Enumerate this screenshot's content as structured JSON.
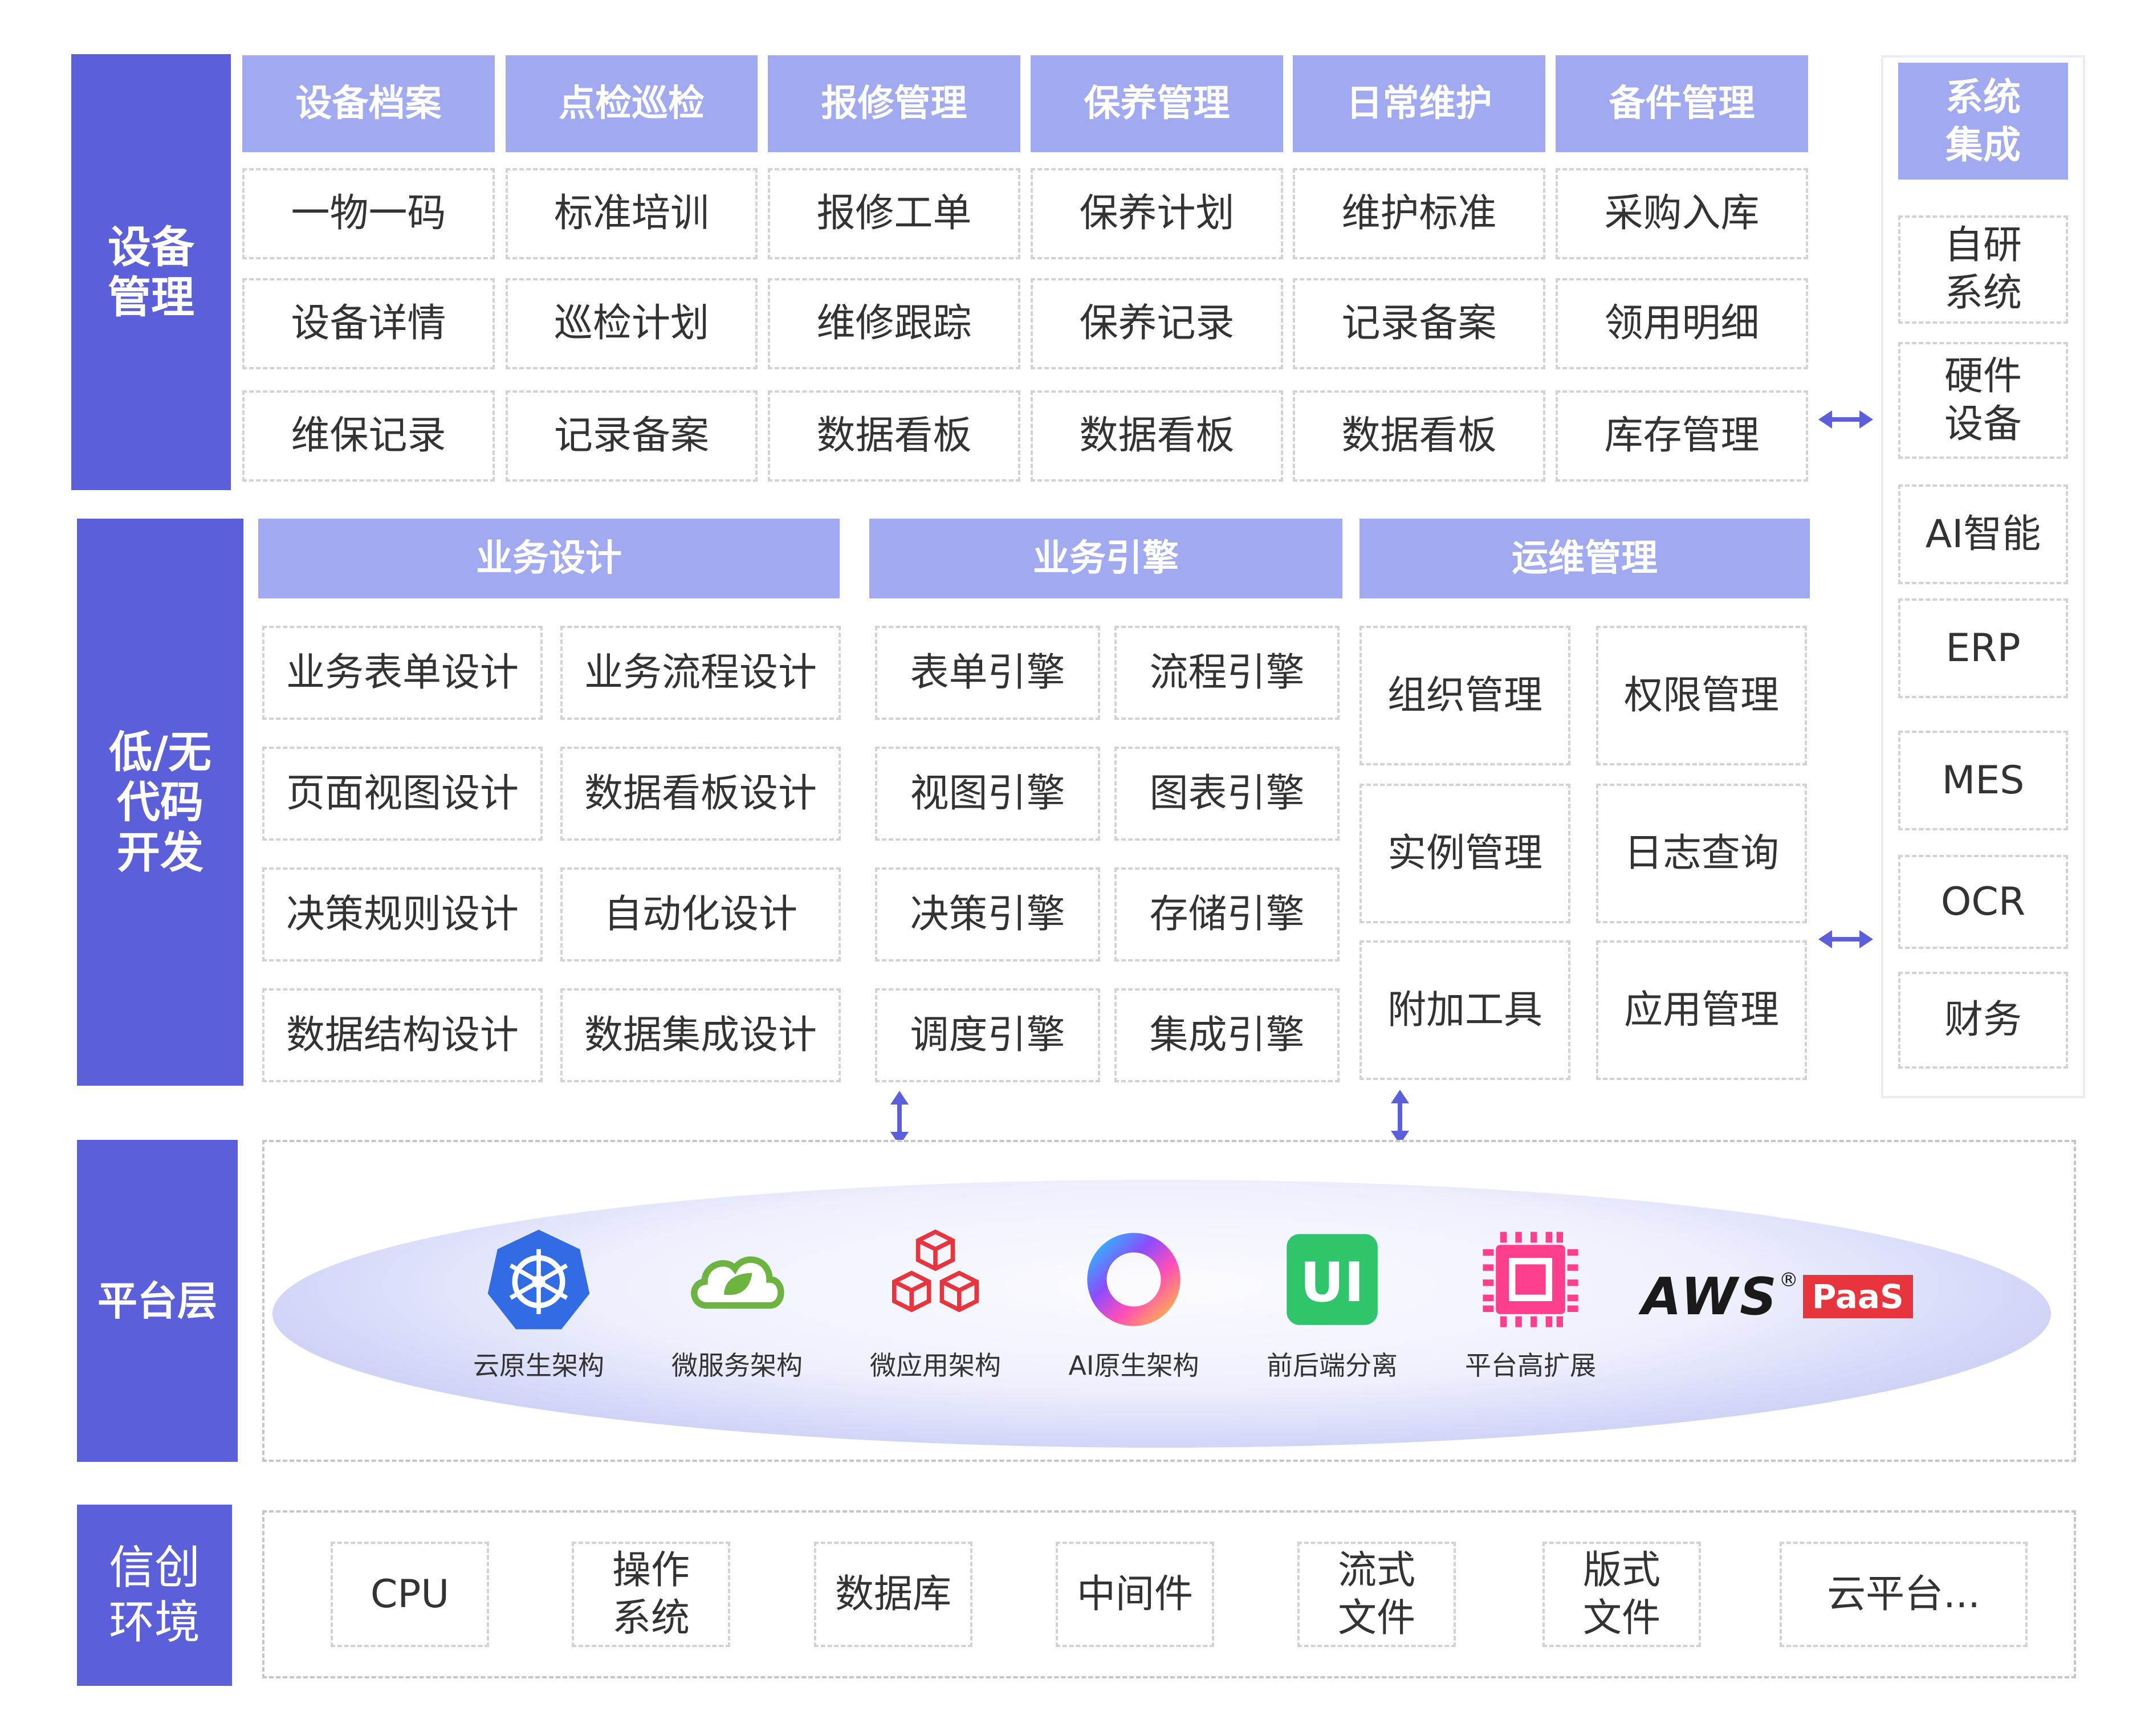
{
  "equipment": {
    "side_label": "设备\n管理",
    "headers": [
      "设备档案",
      "点检巡检",
      "报修管理",
      "保养管理",
      "日常维护",
      "备件管理"
    ],
    "rows": [
      [
        "一物一码",
        "标准培训",
        "报修工单",
        "保养计划",
        "维护标准",
        "采购入库"
      ],
      [
        "设备详情",
        "巡检计划",
        "维修跟踪",
        "保养记录",
        "记录备案",
        "领用明细"
      ],
      [
        "维保记录",
        "记录备案",
        "数据看板",
        "数据看板",
        "数据看板",
        "库存管理"
      ]
    ]
  },
  "system_integration": {
    "header": "系统\n集成",
    "items": [
      "自研\n系统",
      "硬件\n设备",
      "AI智能",
      "ERP",
      "MES",
      "OCR",
      "财务"
    ]
  },
  "lowcode": {
    "side_label": "低/无\n代码\n开发",
    "design": {
      "header": "业务设计",
      "items": [
        "业务表单设计",
        "业务流程设计",
        "页面视图设计",
        "数据看板设计",
        "决策规则设计",
        "自动化设计",
        "数据结构设计",
        "数据集成设计"
      ]
    },
    "engine": {
      "header": "业务引擎",
      "items": [
        "表单引擎",
        "流程引擎",
        "视图引擎",
        "图表引擎",
        "决策引擎",
        "存储引擎",
        "调度引擎",
        "集成引擎"
      ]
    },
    "ops": {
      "header": "运维管理",
      "items": [
        "组织管理",
        "权限管理",
        "实例管理",
        "日志查询",
        "附加工具",
        "应用管理"
      ]
    }
  },
  "platform": {
    "side_label": "平台层",
    "items": [
      {
        "label": "云原生架构",
        "icon": "kubernetes-icon"
      },
      {
        "label": "微服务架构",
        "icon": "spring-cloud-icon"
      },
      {
        "label": "微应用架构",
        "icon": "cubes-icon"
      },
      {
        "label": "AI原生架构",
        "icon": "ai-ring-icon"
      },
      {
        "label": "前后端分离",
        "icon": "ui-icon"
      },
      {
        "label": "平台高扩展",
        "icon": "chip-icon"
      }
    ],
    "logo": {
      "brand": "AWS",
      "registered": "®",
      "badge": "PaaS"
    }
  },
  "xinchuang": {
    "side_label": "信创\n环境",
    "items": [
      "CPU",
      "操作\n系统",
      "数据库",
      "中间件",
      "流式\n文件",
      "版式\n文件",
      "云平台..."
    ]
  },
  "colors": {
    "primary": "#5b5fd9",
    "header": "#a1aaf0",
    "text": "#333333",
    "brand_red": "#e8343c"
  }
}
